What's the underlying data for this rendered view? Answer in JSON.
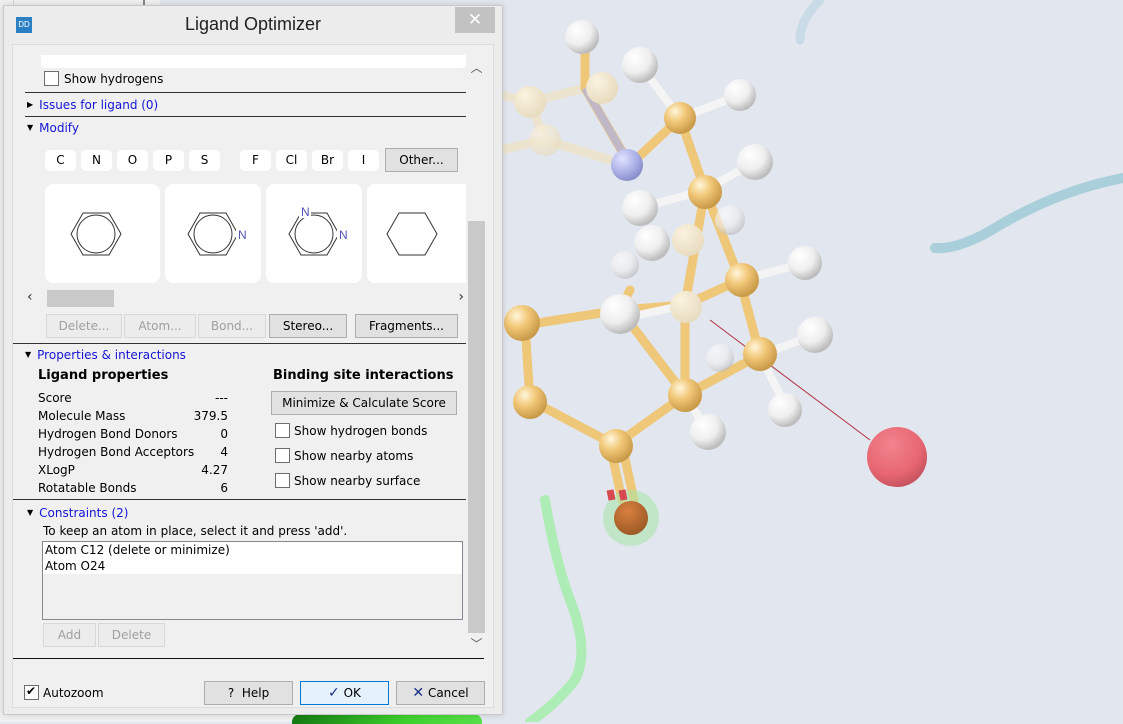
{
  "window": {
    "app_icon_text": "DD",
    "title": "Ligand Optimizer",
    "close_glyph": "✕"
  },
  "display": {
    "show_hydrogens": {
      "label": "Show hydrogens",
      "checked": false
    }
  },
  "sections": {
    "issues": {
      "label": "Issues for ligand (0)",
      "expanded": false
    },
    "modify": {
      "label": "Modify",
      "expanded": true
    },
    "properties": {
      "label": "Properties & interactions",
      "expanded": true
    },
    "constraints": {
      "label": "Constraints (2)",
      "expanded": true
    }
  },
  "modify": {
    "elements": [
      "C",
      "N",
      "O",
      "P",
      "S",
      "F",
      "Cl",
      "Br",
      "I"
    ],
    "other_button": "Other...",
    "fragments": [
      {
        "name": "benzene",
        "hetero_labels": []
      },
      {
        "name": "pyridine",
        "hetero_labels": [
          "N"
        ]
      },
      {
        "name": "pyrimidine",
        "hetero_labels": [
          "N",
          "N"
        ]
      },
      {
        "name": "cyclohexane",
        "hetero_labels": []
      }
    ],
    "hscroll_left": "‹",
    "hscroll_right": "›",
    "actions": {
      "delete": {
        "label": "Delete...",
        "enabled": false
      },
      "atom": {
        "label": "Atom...",
        "enabled": false
      },
      "bond": {
        "label": "Bond...",
        "enabled": false
      },
      "stereo": {
        "label": "Stereo...",
        "enabled": true
      },
      "fragments": {
        "label": "Fragments...",
        "enabled": true
      }
    }
  },
  "properties": {
    "ligand_heading": "Ligand properties",
    "rows": [
      {
        "key": "Score",
        "value": "---"
      },
      {
        "key": "Molecule Mass",
        "value": "379.5"
      },
      {
        "key": "Hydrogen Bond Donors",
        "value": "0"
      },
      {
        "key": "Hydrogen Bond Acceptors",
        "value": "4"
      },
      {
        "key": "XLogP",
        "value": "4.27"
      },
      {
        "key": "Rotatable Bonds",
        "value": "6"
      }
    ],
    "binding_heading": "Binding site interactions",
    "minimize_button": "Minimize & Calculate Score",
    "checkboxes": [
      {
        "label": "Show hydrogen bonds",
        "checked": false
      },
      {
        "label": "Show nearby atoms",
        "checked": false
      },
      {
        "label": "Show nearby surface",
        "checked": false
      }
    ]
  },
  "constraints": {
    "hint": "To keep an atom in place, select it and press 'add'.",
    "items": [
      "Atom C12 (delete or minimize)",
      "Atom O24"
    ],
    "add_button": "Add",
    "delete_button": "Delete"
  },
  "footer": {
    "autozoom": {
      "label": "Autozoom",
      "checked": true
    },
    "help_button": "Help",
    "help_glyph": "?",
    "ok_button": "OK",
    "ok_glyph": "✓",
    "cancel_button": "Cancel",
    "cancel_glyph": "✕"
  },
  "viewer": {
    "colors": {
      "background": "#e2e6ee",
      "carbon": "#f2c97a",
      "hydrogen": "#f2f2f2",
      "nitrogen": "#aeb3e8",
      "oxygen": "#e8606c",
      "constraint_highlight": "#a6e6a8",
      "distance_line": "#b03040"
    }
  }
}
